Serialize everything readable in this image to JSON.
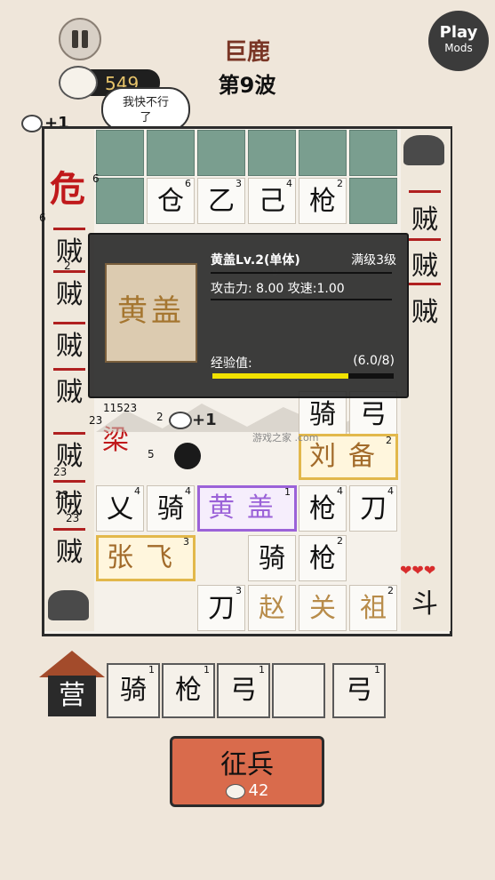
{
  "hud": {
    "pause_icon": "pause-icon",
    "boss_name": "巨鹿",
    "wave_label": "第9波",
    "coins": "549",
    "coin_icon": "steamed-bun-icon",
    "speech_line1": "我快不行",
    "speech_line2": "了",
    "income_popup": "+1",
    "watermark": "游戏之家 .com"
  },
  "play_mods": {
    "line1": "Play",
    "line2": "Mods"
  },
  "danger_badge": "危",
  "enemy_lane": {
    "enemies": [
      "贼",
      "贼",
      "贼",
      "贼",
      "贼",
      "贼",
      "贼",
      "贼"
    ],
    "boss_glyph": "梁",
    "right_enemies": [
      "贼",
      "贼",
      "贼"
    ]
  },
  "board": {
    "row0": [
      {
        "t": "仓",
        "lv": "6"
      },
      {
        "t": "乙",
        "lv": "3"
      },
      {
        "t": "己",
        "lv": "4"
      },
      {
        "t": "枪",
        "lv": "2"
      }
    ],
    "row5": [
      {
        "t": "骑",
        "lv": ""
      },
      {
        "t": "弓",
        "lv": ""
      }
    ],
    "row6": [
      {
        "t": "乂",
        "lv": "4"
      },
      {
        "t": "骑",
        "lv": "4"
      },
      {
        "t": "枪",
        "lv": "4"
      },
      {
        "t": "刀",
        "lv": "4"
      }
    ],
    "row7": [
      {
        "t": "骑",
        "lv": ""
      },
      {
        "t": "枪",
        "lv": "2"
      }
    ],
    "row8": [
      {
        "t": "刀",
        "lv": "3"
      },
      {
        "t": "赵",
        "lv": ""
      },
      {
        "t": "关",
        "lv": ""
      },
      {
        "t": "祖",
        "lv": "2"
      }
    ],
    "heroes": {
      "liu_bei": {
        "name": "刘备",
        "lv": "2"
      },
      "huang_gai": {
        "name": "黄盖",
        "lv": "1"
      },
      "zhang_fei": {
        "name": "张飞",
        "lv": "3"
      }
    },
    "right_unit": "斗",
    "hearts": "❤❤❤"
  },
  "popup": {
    "portrait_name": "黄盖",
    "title": "黄盖Lv.2(单体)",
    "max_level": "满级3级",
    "attack_label": "攻击力:",
    "attack_value": "8.00",
    "speed_label": "攻速:",
    "speed_value": "1.00",
    "exp_label": "经验值:",
    "exp_value": "(6.0/8)",
    "exp_fraction": 0.75
  },
  "floating_numbers": [
    "6",
    "6",
    "2",
    "9",
    "11523",
    "23",
    "2",
    "5",
    "23",
    "23",
    "23"
  ],
  "camp": {
    "label": "营",
    "slots": [
      {
        "t": "骑",
        "lv": "1"
      },
      {
        "t": "枪",
        "lv": "1"
      },
      {
        "t": "弓",
        "lv": "1"
      },
      {
        "t": "",
        "lv": ""
      },
      {
        "t": "弓",
        "lv": "1"
      }
    ]
  },
  "recruit": {
    "label": "征兵",
    "cost": "42"
  },
  "colors": {
    "danger": "#c0191b",
    "gold_border": "#e2b84b",
    "purple_border": "#9b62d8",
    "recruit_button": "#d96b4c",
    "exp_bar": "#f2e200"
  }
}
